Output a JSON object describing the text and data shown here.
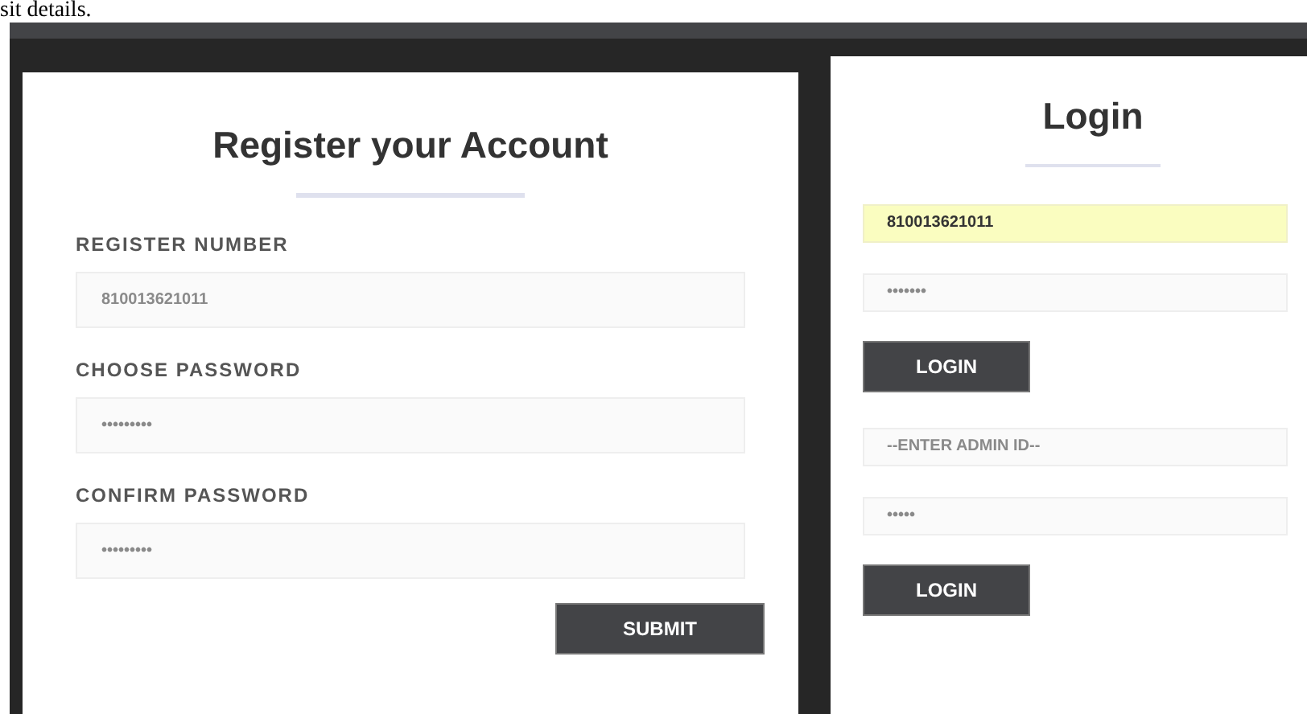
{
  "page_text": "sit details.",
  "register": {
    "title": "Register your Account",
    "fields": [
      {
        "label": "REGISTER NUMBER",
        "placeholder": "810013621011"
      },
      {
        "label": "CHOOSE PASSWORD",
        "placeholder": "•••••••••"
      },
      {
        "label": "CONFIRM PASSWORD",
        "placeholder": "•••••••••"
      }
    ],
    "button": "SUBMIT"
  },
  "login": {
    "title": "Login",
    "groups": [
      {
        "fields": [
          {
            "value": "810013621011",
            "autofilled": true
          },
          {
            "placeholder": "•••••••",
            "autofilled": false
          }
        ],
        "button": "LOGIN"
      },
      {
        "fields": [
          {
            "placeholder": "--ENTER ADMIN ID--",
            "autofilled": false
          },
          {
            "placeholder": "•••••",
            "autofilled": false
          }
        ],
        "button": "LOGIN"
      }
    ]
  }
}
